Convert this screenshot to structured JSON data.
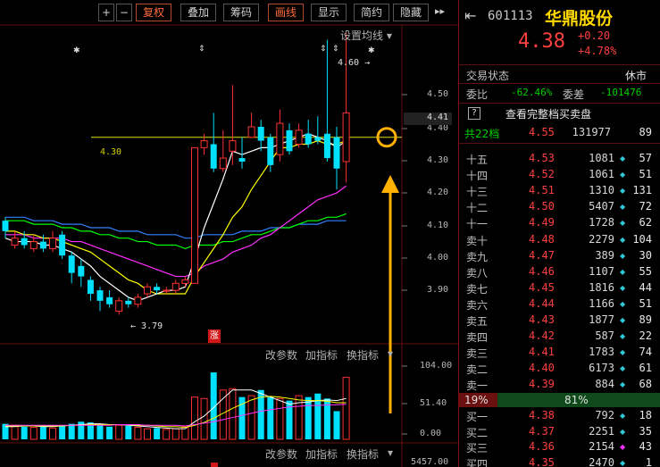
{
  "toolbar": {
    "buttons": [
      {
        "label": "+",
        "active": false
      },
      {
        "label": "−",
        "active": false
      },
      {
        "label": "复权",
        "active": true
      },
      {
        "label": "叠加",
        "active": false
      },
      {
        "label": "筹码",
        "active": false
      },
      {
        "label": "画线",
        "active": true
      },
      {
        "label": "显示",
        "active": false
      },
      {
        "label": "简约",
        "active": false
      },
      {
        "label": "隐藏",
        "active": false
      }
    ],
    "settings_label": "设置均线",
    "dropdown_glyph": "▾"
  },
  "chart": {
    "price_ticks": [
      "4.50",
      "4.40",
      "4.30",
      "4.20",
      "4.10",
      "4.00",
      "3.90"
    ],
    "current_price_tag": "4.41",
    "high_label": "4.60",
    "low_label": "3.79",
    "hline_label": "4.30",
    "limit_up_tag": "涨",
    "star_glyph": "✱",
    "arrow_glyph": "⇕",
    "colors": {
      "up": "#ff3030",
      "down": "#00e0ff",
      "ma5": "#ffffff",
      "ma10": "#ffff00",
      "ma20": "#ff30ff",
      "ma60": "#00ff00",
      "ma120": "#3080ff",
      "highlight": "#ffb000"
    }
  },
  "chart_data": {
    "type": "candlestick",
    "xlabel": "",
    "ylabel": "",
    "ylim": [
      3.75,
      4.62
    ],
    "candles": [
      {
        "o": 4.06,
        "c": 4.03,
        "h": 4.07,
        "l": 4.01
      },
      {
        "o": 3.99,
        "c": 4.01,
        "h": 4.03,
        "l": 3.98
      },
      {
        "o": 4.01,
        "c": 3.99,
        "h": 4.03,
        "l": 3.98
      },
      {
        "o": 3.98,
        "c": 4.0,
        "h": 4.02,
        "l": 3.97
      },
      {
        "o": 4.0,
        "c": 3.98,
        "h": 4.02,
        "l": 3.97
      },
      {
        "o": 3.98,
        "c": 4.01,
        "h": 4.03,
        "l": 3.97
      },
      {
        "o": 4.02,
        "c": 3.96,
        "h": 4.03,
        "l": 3.95
      },
      {
        "o": 3.96,
        "c": 3.91,
        "h": 3.97,
        "l": 3.88
      },
      {
        "o": 3.93,
        "c": 3.9,
        "h": 3.95,
        "l": 3.87
      },
      {
        "o": 3.89,
        "c": 3.85,
        "h": 3.9,
        "l": 3.83
      },
      {
        "o": 3.86,
        "c": 3.83,
        "h": 3.87,
        "l": 3.8
      },
      {
        "o": 3.84,
        "c": 3.82,
        "h": 3.86,
        "l": 3.81
      },
      {
        "o": 3.8,
        "c": 3.83,
        "h": 3.84,
        "l": 3.79
      },
      {
        "o": 3.83,
        "c": 3.82,
        "h": 3.84,
        "l": 3.81
      },
      {
        "o": 3.82,
        "c": 3.84,
        "h": 3.85,
        "l": 3.81
      },
      {
        "o": 3.85,
        "c": 3.87,
        "h": 3.88,
        "l": 3.84
      },
      {
        "o": 3.87,
        "c": 3.86,
        "h": 3.88,
        "l": 3.85
      },
      {
        "o": 3.86,
        "c": 3.86,
        "h": 3.87,
        "l": 3.85
      },
      {
        "o": 3.86,
        "c": 3.88,
        "h": 3.89,
        "l": 3.85
      },
      {
        "o": 3.88,
        "c": 3.89,
        "h": 3.9,
        "l": 3.87
      },
      {
        "o": 3.88,
        "c": 4.27,
        "h": 4.27,
        "l": 3.88
      },
      {
        "o": 4.27,
        "c": 4.29,
        "h": 4.31,
        "l": 4.25
      },
      {
        "o": 4.28,
        "c": 4.21,
        "h": 4.37,
        "l": 4.2
      },
      {
        "o": 4.21,
        "c": 4.24,
        "h": 4.32,
        "l": 4.2
      },
      {
        "o": 4.26,
        "c": 4.29,
        "h": 4.45,
        "l": 4.22
      },
      {
        "o": 4.24,
        "c": 4.23,
        "h": 4.3,
        "l": 4.21
      },
      {
        "o": 4.3,
        "c": 4.33,
        "h": 4.37,
        "l": 4.3
      },
      {
        "o": 4.33,
        "c": 4.29,
        "h": 4.35,
        "l": 4.26
      },
      {
        "o": 4.3,
        "c": 4.22,
        "h": 4.31,
        "l": 4.2
      },
      {
        "o": 4.25,
        "c": 4.34,
        "h": 4.38,
        "l": 4.23
      },
      {
        "o": 4.32,
        "c": 4.26,
        "h": 4.34,
        "l": 4.25
      },
      {
        "o": 4.28,
        "c": 4.32,
        "h": 4.34,
        "l": 4.27
      },
      {
        "o": 4.31,
        "c": 4.28,
        "h": 4.35,
        "l": 4.27
      },
      {
        "o": 4.3,
        "c": 4.29,
        "h": 4.36,
        "l": 4.28
      },
      {
        "o": 4.31,
        "c": 4.24,
        "h": 4.58,
        "l": 4.23
      },
      {
        "o": 4.3,
        "c": 4.21,
        "h": 4.33,
        "l": 4.15
      },
      {
        "o": 4.23,
        "c": 4.37,
        "h": 4.6,
        "l": 4.17
      }
    ],
    "ma": {
      "ma5": [
        4.01,
        4.0,
        4.0,
        4.0,
        3.99,
        3.99,
        3.98,
        3.97,
        3.95,
        3.93,
        3.9,
        3.88,
        3.86,
        3.84,
        3.83,
        3.84,
        3.85,
        3.86,
        3.86,
        3.87,
        3.95,
        4.04,
        4.11,
        4.18,
        4.26,
        4.25,
        4.26,
        4.27,
        4.27,
        4.28,
        4.29,
        4.3,
        4.31,
        4.3,
        4.29,
        4.27,
        4.29
      ],
      "ma10": [
        4.03,
        4.03,
        4.02,
        4.02,
        4.01,
        4.01,
        4.0,
        3.99,
        3.98,
        3.97,
        3.95,
        3.93,
        3.91,
        3.89,
        3.88,
        3.86,
        3.85,
        3.85,
        3.85,
        3.85,
        3.9,
        3.94,
        3.98,
        4.02,
        4.07,
        4.1,
        4.15,
        4.19,
        4.23,
        4.27,
        4.27,
        4.28,
        4.28,
        4.29,
        4.28,
        4.28,
        4.29
      ],
      "ma20": [
        4.02,
        4.02,
        4.02,
        4.01,
        4.01,
        4.01,
        4.01,
        4.0,
        4.0,
        3.99,
        3.98,
        3.97,
        3.96,
        3.95,
        3.94,
        3.93,
        3.92,
        3.91,
        3.9,
        3.9,
        3.91,
        3.93,
        3.94,
        3.95,
        3.97,
        3.98,
        3.99,
        4.01,
        4.02,
        4.04,
        4.06,
        4.08,
        4.1,
        4.12,
        4.13,
        4.14,
        4.16
      ],
      "ma60": [
        4.06,
        4.06,
        4.06,
        4.05,
        4.05,
        4.05,
        4.04,
        4.04,
        4.03,
        4.03,
        4.02,
        4.02,
        4.01,
        4.01,
        4.0,
        4.0,
        3.99,
        3.99,
        3.99,
        3.98,
        3.99,
        3.99,
        3.99,
        4.0,
        4.0,
        4.01,
        4.02,
        4.02,
        4.03,
        4.04,
        4.04,
        4.05,
        4.06,
        4.06,
        4.07,
        4.07,
        4.08
      ],
      "ma120": [
        4.07,
        4.07,
        4.07,
        4.06,
        4.06,
        4.06,
        4.05,
        4.05,
        4.05,
        4.04,
        4.04,
        4.04,
        4.03,
        4.03,
        4.03,
        4.02,
        4.02,
        4.02,
        4.02,
        4.01,
        4.01,
        4.02,
        4.02,
        4.02,
        4.02,
        4.03,
        4.03,
        4.03,
        4.04,
        4.04,
        4.04,
        4.05,
        4.05,
        4.05,
        4.06,
        4.06,
        4.06
      ]
    },
    "volume": {
      "ylim": [
        0,
        104
      ],
      "ticks": [
        "104.00",
        "51.40",
        "0.00"
      ],
      "values": [
        22,
        20,
        18,
        17,
        18,
        16,
        20,
        22,
        25,
        24,
        22,
        18,
        20,
        19,
        17,
        15,
        16,
        14,
        15,
        18,
        60,
        58,
        95,
        70,
        72,
        60,
        62,
        70,
        60,
        58,
        55,
        62,
        60,
        65,
        58,
        40,
        88
      ],
      "lines": {
        "white": [
          18,
          18,
          19,
          19,
          18,
          18,
          19,
          20,
          21,
          22,
          22,
          21,
          21,
          20,
          19,
          18,
          17,
          16,
          15,
          15,
          25,
          33,
          45,
          58,
          70,
          70,
          70,
          65,
          60,
          55,
          50,
          52,
          53,
          55,
          56,
          55,
          58
        ],
        "yellow": [
          19,
          19,
          19,
          19,
          19,
          19,
          19,
          20,
          20,
          21,
          21,
          21,
          21,
          21,
          20,
          20,
          19,
          18,
          18,
          17,
          20,
          24,
          30,
          37,
          44,
          50,
          56,
          60,
          61,
          60,
          58,
          56,
          55,
          55,
          54,
          52,
          52
        ],
        "magenta": [
          20,
          20,
          20,
          20,
          20,
          20,
          20,
          20,
          20,
          20,
          20,
          20,
          21,
          21,
          21,
          20,
          20,
          20,
          20,
          19,
          21,
          23,
          25,
          28,
          31,
          34,
          37,
          40,
          42,
          44,
          46,
          47,
          48,
          48,
          49,
          49,
          50
        ]
      }
    },
    "series": []
  },
  "indicator_links": [
    "改参数",
    "加指标",
    "换指标"
  ],
  "panel": {
    "code": "601113",
    "name": "华鼎股份",
    "price": "4.38",
    "change": "+0.20",
    "change_pct": "+4.78%",
    "status_label": "交易状态",
    "status_value": "休市",
    "wb_label": "委比",
    "wb_value": "-62.46%",
    "wc_label": "委差",
    "wc_value": "-101476",
    "q_icon": "?",
    "full_book_link": "查看完整档买卖盘",
    "total_label": "共22档",
    "total_price": "4.55",
    "total_vol": "131977",
    "total_count": "89",
    "asks": [
      {
        "lvl": "十五",
        "px": "4.53",
        "vol": "1081",
        "cnt": "57"
      },
      {
        "lvl": "十四",
        "px": "4.52",
        "vol": "1061",
        "cnt": "51"
      },
      {
        "lvl": "十三",
        "px": "4.51",
        "vol": "1310",
        "cnt": "131"
      },
      {
        "lvl": "十二",
        "px": "4.50",
        "vol": "5407",
        "cnt": "72"
      },
      {
        "lvl": "十一",
        "px": "4.49",
        "vol": "1728",
        "cnt": "62"
      },
      {
        "lvl": "卖十",
        "px": "4.48",
        "vol": "2279",
        "cnt": "104"
      },
      {
        "lvl": "卖九",
        "px": "4.47",
        "vol": "389",
        "cnt": "30"
      },
      {
        "lvl": "卖八",
        "px": "4.46",
        "vol": "1107",
        "cnt": "55"
      },
      {
        "lvl": "卖七",
        "px": "4.45",
        "vol": "1816",
        "cnt": "44"
      },
      {
        "lvl": "卖六",
        "px": "4.44",
        "vol": "1166",
        "cnt": "51"
      },
      {
        "lvl": "卖五",
        "px": "4.43",
        "vol": "1877",
        "cnt": "89"
      },
      {
        "lvl": "卖四",
        "px": "4.42",
        "vol": "587",
        "cnt": "22"
      },
      {
        "lvl": "卖三",
        "px": "4.41",
        "vol": "1783",
        "cnt": "74"
      },
      {
        "lvl": "卖二",
        "px": "4.40",
        "vol": "6173",
        "cnt": "61"
      },
      {
        "lvl": "卖一",
        "px": "4.39",
        "vol": "884",
        "cnt": "68"
      }
    ],
    "ratio_left": "19%",
    "ratio_right": "81%",
    "ratio_fraction": 0.19,
    "bids": [
      {
        "lvl": "买一",
        "px": "4.38",
        "vol": "792",
        "cnt": "18"
      },
      {
        "lvl": "买二",
        "px": "4.37",
        "vol": "2251",
        "cnt": "35"
      },
      {
        "lvl": "买三",
        "px": "4.36",
        "vol": "2154",
        "cnt": "43"
      },
      {
        "lvl": "买四",
        "px": "4.35",
        "vol": "2470",
        "cnt": "1"
      }
    ],
    "diamond": "◆"
  }
}
